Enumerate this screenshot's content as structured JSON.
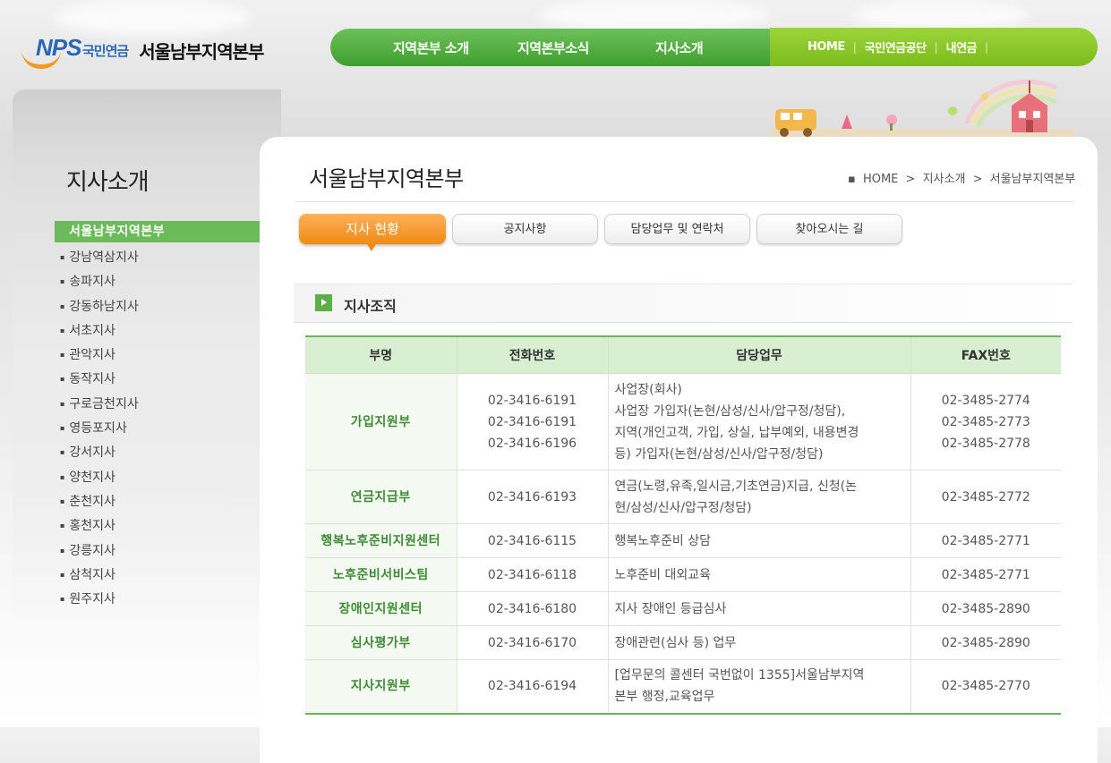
{
  "header": {
    "logo_nps": "NPS",
    "logo_org": "국민연금",
    "logo_region": "서울남부지역본부",
    "gnb": [
      "지역본부 소개",
      "지역본부소식",
      "지사소개"
    ],
    "util": [
      "HOME",
      "국민연금공단",
      "내연금"
    ]
  },
  "sidebar": {
    "title": "지사소개",
    "active": "서울남부지역본부",
    "items": [
      "강남역삼지사",
      "송파지사",
      "강동하남지사",
      "서초지사",
      "관악지사",
      "동작지사",
      "구로금천지사",
      "영등포지사",
      "강서지사",
      "양천지사",
      "춘천지사",
      "홍천지사",
      "강릉지사",
      "삼척지사",
      "원주지사"
    ]
  },
  "content": {
    "title": "서울남부지역본부",
    "breadcrumb": [
      "HOME",
      "지사소개",
      "서울남부지역본부"
    ],
    "tabs": [
      "지사 현황",
      "공지사항",
      "담당업무 및 연락처",
      "찾아오시는 길"
    ],
    "section_title": "지사조직"
  },
  "table": {
    "headers": [
      "부명",
      "전화번호",
      "담당업무",
      "FAX번호"
    ],
    "rows": [
      {
        "dept": "가입지원부",
        "phone": [
          "02-3416-6191",
          "02-3416-6191",
          "02-3416-6196"
        ],
        "duty": [
          "사업장(회사)",
          "사업장 가입자(논현/삼성/신사/압구정/청담),",
          "지역(개인고객, 가입, 상실, 납부예외, 내용변경",
          "등) 가입자(논현/삼성/신사/압구정/청담)"
        ],
        "fax": [
          "02-3485-2774",
          "02-3485-2773",
          "02-3485-2778"
        ]
      },
      {
        "dept": "연금지급부",
        "phone": [
          "02-3416-6193"
        ],
        "duty": [
          "연금(노령,유족,일시금,기초연금)지급, 신청(논",
          "현/삼성/신사/압구정/청담)"
        ],
        "fax": [
          "02-3485-2772"
        ]
      },
      {
        "dept": "행복노후준비지원센터",
        "phone": [
          "02-3416-6115"
        ],
        "duty": [
          "행복노후준비 상담"
        ],
        "fax": [
          "02-3485-2771"
        ]
      },
      {
        "dept": "노후준비서비스팀",
        "phone": [
          "02-3416-6118"
        ],
        "duty": [
          "노후준비 대외교육"
        ],
        "fax": [
          "02-3485-2771"
        ]
      },
      {
        "dept": "장애인지원센터",
        "phone": [
          "02-3416-6180"
        ],
        "duty": [
          "지사 장애인 등급심사"
        ],
        "fax": [
          "02-3485-2890"
        ]
      },
      {
        "dept": "심사평가부",
        "phone": [
          "02-3416-6170"
        ],
        "duty": [
          "장애관련(심사 등) 업무"
        ],
        "fax": [
          "02-3485-2890"
        ]
      },
      {
        "dept": "지사지원부",
        "phone": [
          "02-3416-6194"
        ],
        "duty": [
          "[업무문의 콜센터 국번없이 1355]서울남부지역",
          "본부 행정,교육업무"
        ],
        "fax": [
          "02-3485-2770"
        ]
      }
    ]
  },
  "colors": {
    "green": "#5cb04a",
    "orange": "#f08a15",
    "lime": "#8cc62a",
    "blue": "#2a67b6"
  }
}
